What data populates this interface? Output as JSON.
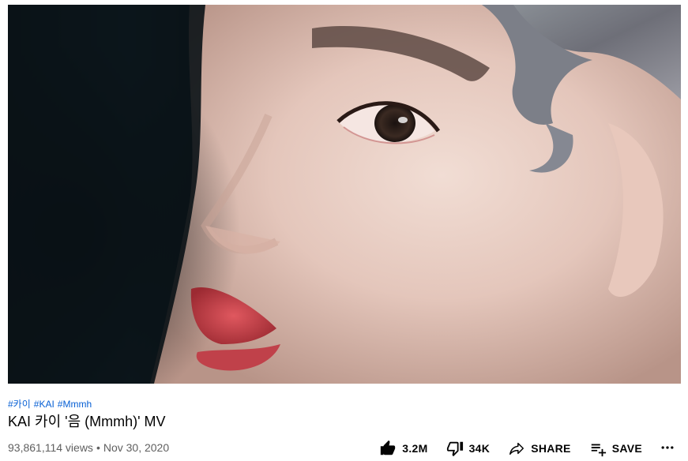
{
  "video": {
    "thumbnail_icon": "video-frame-closeup-face"
  },
  "hashtags": [
    "#카이",
    "#KAI",
    "#Mmmh"
  ],
  "title": "KAI 카이 '음 (Mmmh)' MV",
  "meta": {
    "views": "93,861,114 views",
    "separator": "•",
    "date": "Nov 30, 2020"
  },
  "actions": {
    "like": {
      "icon": "thumbs-up-icon",
      "label": "3.2M"
    },
    "dislike": {
      "icon": "thumbs-down-icon",
      "label": "34K"
    },
    "share": {
      "icon": "share-arrow-icon",
      "label": "SHARE"
    },
    "save": {
      "icon": "playlist-add-icon",
      "label": "SAVE"
    },
    "more": {
      "icon": "more-horizontal-icon"
    }
  },
  "colors": {
    "link": "#065fd4",
    "text": "#030303",
    "secondary_text": "#606060",
    "background": "#ffffff"
  }
}
